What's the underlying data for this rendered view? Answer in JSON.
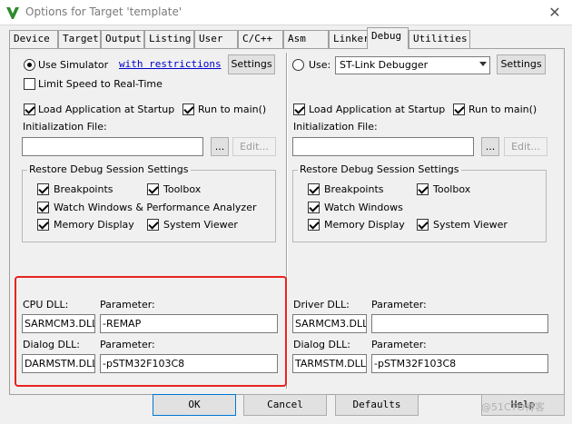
{
  "window": {
    "title": "Options for Target 'template'",
    "close_label": "✕"
  },
  "tabs": [
    "Device",
    "Target",
    "Output",
    "Listing",
    "User",
    "C/C++",
    "Asm",
    "Linker",
    "Debug",
    "Utilities"
  ],
  "active_tab": "Debug",
  "left": {
    "use_simulator_label": "Use Simulator",
    "restrictions_link": "with restrictions",
    "settings_label": "Settings",
    "limit_speed_label": "Limit Speed to Real-Time",
    "load_app_label": "Load Application at Startup",
    "run_to_main_label": "Run to main()",
    "init_file_label": "Initialization File:",
    "browse_label": "...",
    "edit_label": "Edit...",
    "restore_group_title": "Restore Debug Session Settings",
    "breakpoints_label": "Breakpoints",
    "toolbox_label": "Toolbox",
    "watch_label": "Watch Windows & Performance Analyzer",
    "memory_label": "Memory Display",
    "system_viewer_label": "System Viewer",
    "cpu_dll_label": "CPU DLL:",
    "cpu_param_label": "Parameter:",
    "cpu_dll_value": "SARMCM3.DLL",
    "cpu_param_value": "-REMAP",
    "dialog_dll_label": "Dialog DLL:",
    "dialog_param_label": "Parameter:",
    "dialog_dll_value": "DARMSTM.DLL",
    "dialog_param_value": "-pSTM32F103C8"
  },
  "right": {
    "use_label": "Use:",
    "debugger_value": "ST-Link Debugger",
    "settings_label": "Settings",
    "load_app_label": "Load Application at Startup",
    "run_to_main_label": "Run to main()",
    "init_file_label": "Initialization File:",
    "browse_label": "...",
    "edit_label": "Edit...",
    "restore_group_title": "Restore Debug Session Settings",
    "breakpoints_label": "Breakpoints",
    "toolbox_label": "Toolbox",
    "watch_label": "Watch Windows",
    "memory_label": "Memory Display",
    "system_viewer_label": "System Viewer",
    "driver_dll_label": "Driver DLL:",
    "driver_param_label": "Parameter:",
    "driver_dll_value": "SARMCM3.DLL",
    "driver_param_value": "",
    "dialog_dll_label": "Dialog DLL:",
    "dialog_param_label": "Parameter:",
    "dialog_dll_value": "TARMSTM.DLL",
    "dialog_param_value": "-pSTM32F103C8"
  },
  "footer": {
    "ok": "OK",
    "cancel": "Cancel",
    "defaults": "Defaults",
    "help": "Help"
  },
  "watermark": "@51CTO博客",
  "colors": {
    "highlight": "#e8231f",
    "link": "#0000cc",
    "icon_green": "#2e8b2e"
  }
}
